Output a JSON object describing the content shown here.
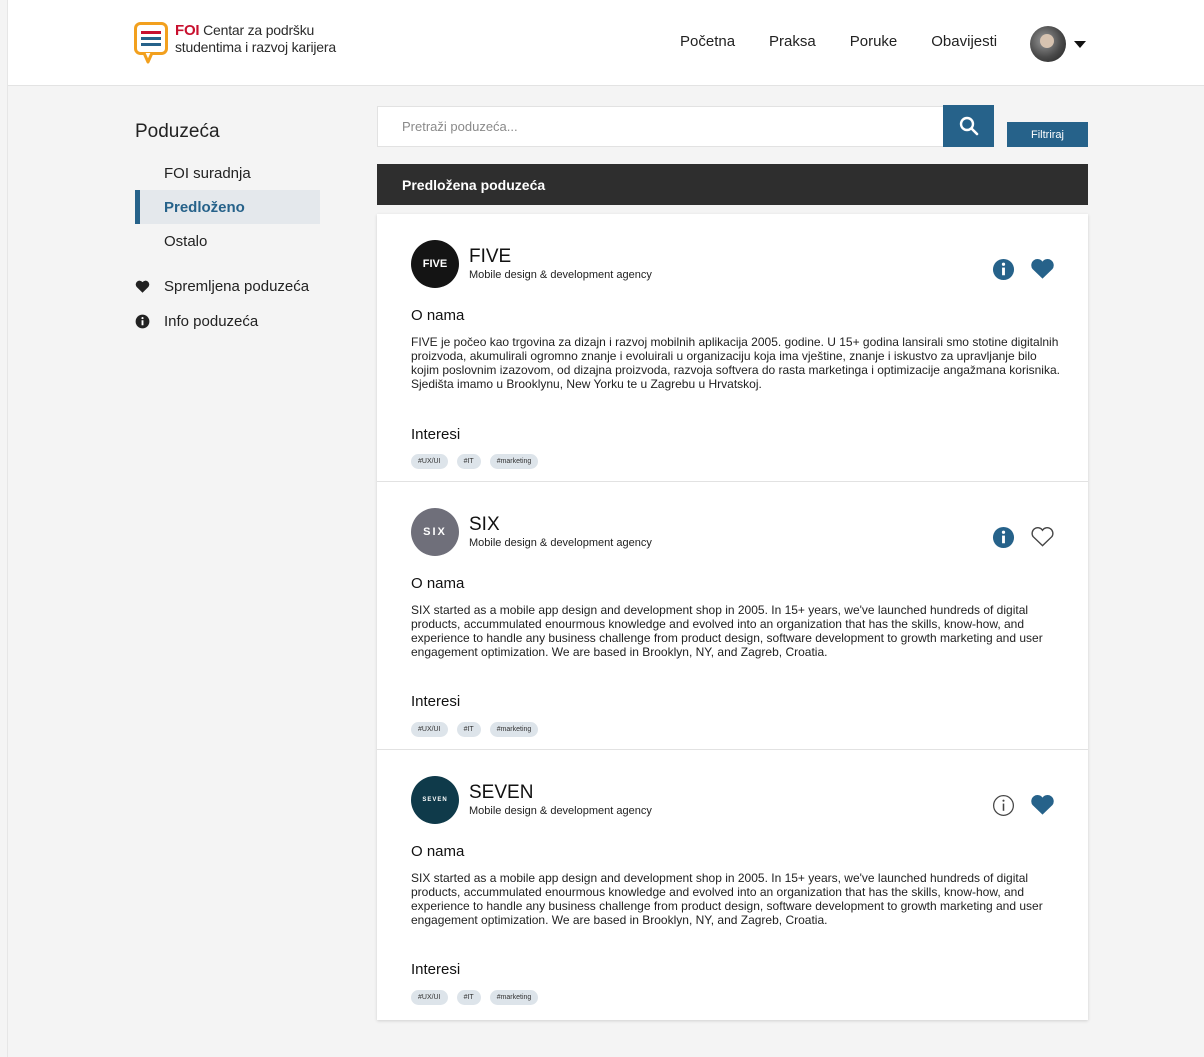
{
  "header": {
    "logo_brand": "FOI",
    "logo_line1": "Centar za podršku",
    "logo_line2": "studentima i razvoj karijera",
    "nav": [
      "Početna",
      "Praksa",
      "Poruke",
      "Obavijesti"
    ],
    "brand_color": "#26628a"
  },
  "sidebar": {
    "title": "Poduzeća",
    "items": [
      {
        "label": "FOI suradnja",
        "active": false
      },
      {
        "label": "Predloženo",
        "active": true
      },
      {
        "label": "Ostalo",
        "active": false
      }
    ],
    "saved_label": "Spremljena poduzeća",
    "info_label": "Info poduzeća"
  },
  "search": {
    "placeholder": "Pretraži poduzeća...",
    "filter_label": "Filtriraj"
  },
  "section_title": "Predložena poduzeća",
  "companies": [
    {
      "name": "FIVE",
      "logo_text": "FIVE",
      "subtitle": "Mobile design & development agency",
      "about_heading": "O nama",
      "about": "FIVE je počeo kao trgovina za dizajn i razvoj mobilnih aplikacija 2005. godine. U 15+ godina lansirali smo stotine digitalnih proizvoda, akumulirali ogromno znanje i evoluirali u organizaciju koja ima vještine, znanje i iskustvo za upravljanje bilo kojim poslovnim izazovom, od dizajna proizvoda, razvoja softvera do rasta marketinga i optimizacije angažmana korisnika. Sjedišta imamo u Brooklynu, New Yorku te u Zagrebu u Hrvatskoj.",
      "interests_heading": "Interesi",
      "tags": [
        "#UX/UI",
        "#IT",
        "#marketing"
      ],
      "info_filled": true,
      "favorite": true
    },
    {
      "name": "SIX",
      "logo_text": "SIX",
      "subtitle": "Mobile design & development agency",
      "about_heading": "O nama",
      "about": "SIX started as a mobile app design and development shop in 2005. In 15+ years, we've launched hundreds of digital products, accummulated enourmous knowledge and evolved into an organization that has the skills, know-how, and experience to handle any business challenge from product design, software development to growth marketing and user engagement optimization. We are based in Brooklyn, NY, and Zagreb, Croatia.",
      "interests_heading": "Interesi",
      "tags": [
        "#UX/UI",
        "#IT",
        "#marketing"
      ],
      "info_filled": true,
      "favorite": false
    },
    {
      "name": "SEVEN",
      "logo_text": "SEVEN",
      "subtitle": "Mobile design & development agency",
      "about_heading": "O nama",
      "about": "SIX started as a mobile app design and development shop in 2005. In 15+ years, we've launched hundreds of digital products, accummulated enourmous knowledge and evolved into an organization that has the skills, know-how, and experience to handle any business challenge from product design, software development to growth marketing and user engagement optimization. We are based in Brooklyn, NY, and Zagreb, Croatia.",
      "interests_heading": "Interesi",
      "tags": [
        "#UX/UI",
        "#IT",
        "#marketing"
      ],
      "info_filled": false,
      "favorite": true
    }
  ]
}
